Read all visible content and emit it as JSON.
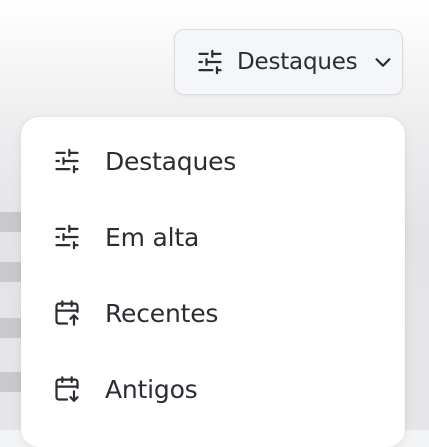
{
  "sort": {
    "selected_label": "Destaques",
    "icon": "sliders-icon"
  },
  "menu": {
    "items": [
      {
        "label": "Destaques",
        "icon": "sliders-icon"
      },
      {
        "label": "Em alta",
        "icon": "sliders-icon"
      },
      {
        "label": "Recentes",
        "icon": "calendar-arrow-up-icon"
      },
      {
        "label": "Antigos",
        "icon": "calendar-arrow-down-icon"
      }
    ]
  },
  "colors": {
    "text": "#2b2d33",
    "menu_background": "#ffffff",
    "trigger_background": "#f5f6f8",
    "border": "#dcdde2"
  }
}
